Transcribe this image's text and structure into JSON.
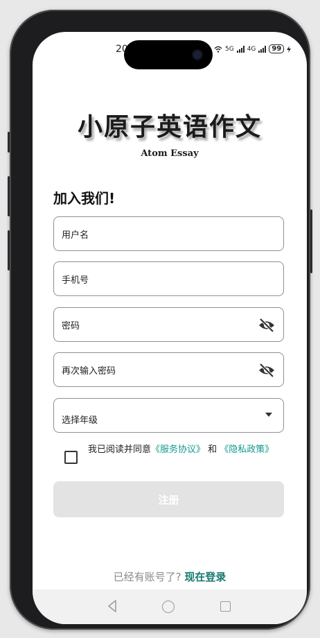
{
  "status": {
    "time": "20",
    "net1": "5G",
    "net2": "4G",
    "battery": "99"
  },
  "app": {
    "title": "小原子英语作文",
    "subtitle": "Atom Essay"
  },
  "form": {
    "heading": "加入我们!",
    "username_placeholder": "用户名",
    "phone_placeholder": "手机号",
    "password_placeholder": "密码",
    "confirm_password_placeholder": "再次输入密码",
    "grade_placeholder": "选择年级"
  },
  "agreement": {
    "prefix": "我已阅读并同意",
    "service_link": "《服务协议》",
    "conjunction": " 和 ",
    "privacy_link": "《隐私政策》"
  },
  "register_button": "注册",
  "login": {
    "prompt": "已经有账号了? ",
    "link": "现在登录"
  },
  "colors": {
    "accent": "#129a8c",
    "login_link": "#15796f",
    "button_disabled": "#e3e3e3"
  }
}
